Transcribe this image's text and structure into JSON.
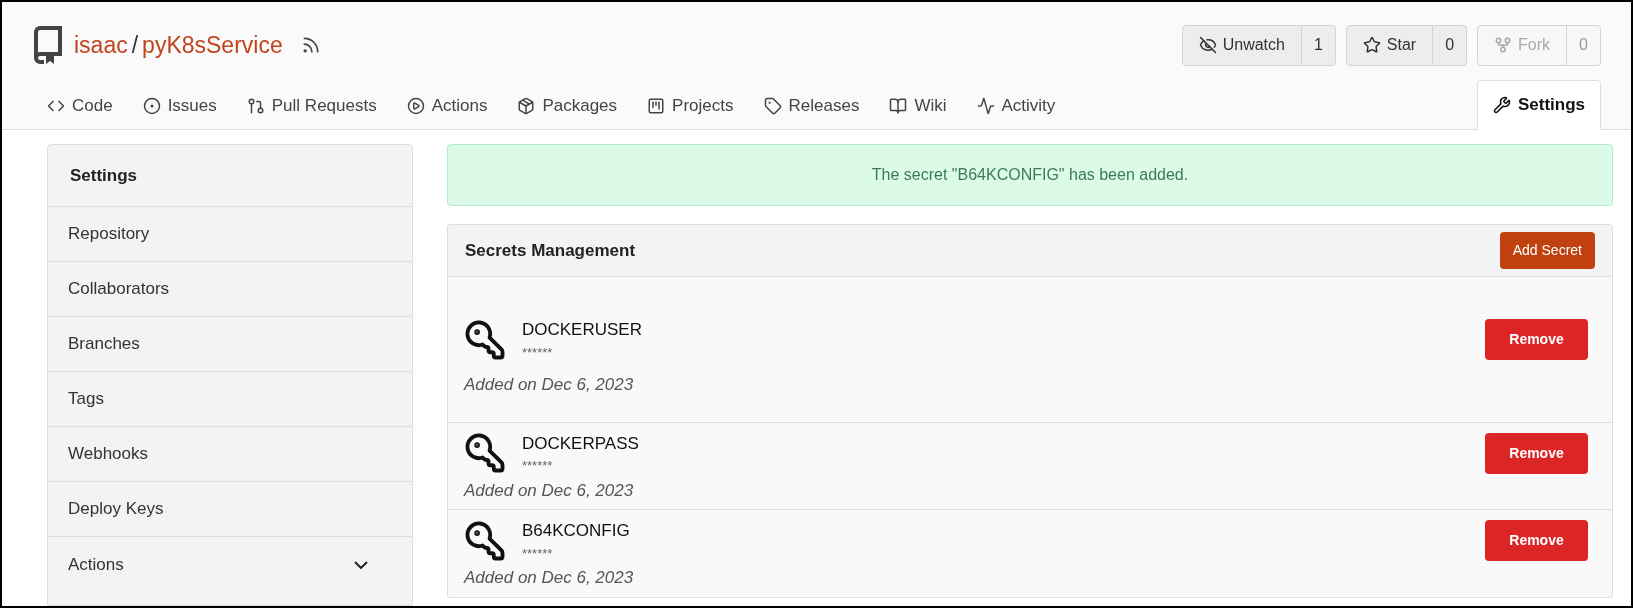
{
  "repo": {
    "owner": "isaac",
    "separator": "/",
    "name": "pyK8sService"
  },
  "actions": [
    {
      "label": "Unwatch",
      "count": "1",
      "disabled": false
    },
    {
      "label": "Star",
      "count": "0",
      "disabled": false
    },
    {
      "label": "Fork",
      "count": "0",
      "disabled": true
    }
  ],
  "tabs": [
    {
      "label": "Code",
      "selected": false
    },
    {
      "label": "Issues",
      "selected": false
    },
    {
      "label": "Pull Requests",
      "selected": false
    },
    {
      "label": "Actions",
      "selected": false
    },
    {
      "label": "Packages",
      "selected": false
    },
    {
      "label": "Projects",
      "selected": false
    },
    {
      "label": "Releases",
      "selected": false
    },
    {
      "label": "Wiki",
      "selected": false
    },
    {
      "label": "Activity",
      "selected": false
    },
    {
      "label": "Settings",
      "selected": true
    }
  ],
  "sidebar": {
    "title": "Settings",
    "items": [
      {
        "label": "Repository"
      },
      {
        "label": "Collaborators"
      },
      {
        "label": "Branches"
      },
      {
        "label": "Tags"
      },
      {
        "label": "Webhooks"
      },
      {
        "label": "Deploy Keys"
      },
      {
        "label": "Actions",
        "expanded": false
      }
    ]
  },
  "alert": "The secret \"B64KCONFIG\" has been added.",
  "secrets": {
    "title": "Secrets Management",
    "add_button": "Add Secret",
    "items": [
      {
        "name": "DOCKERUSER",
        "value": "******",
        "added": "Added on Dec 6, 2023",
        "remove": "Remove"
      },
      {
        "name": "DOCKERPASS",
        "value": "******",
        "added": "Added on Dec 6, 2023",
        "remove": "Remove"
      },
      {
        "name": "B64KCONFIG",
        "value": "******",
        "added": "Added on Dec 6, 2023",
        "remove": "Remove"
      }
    ]
  }
}
